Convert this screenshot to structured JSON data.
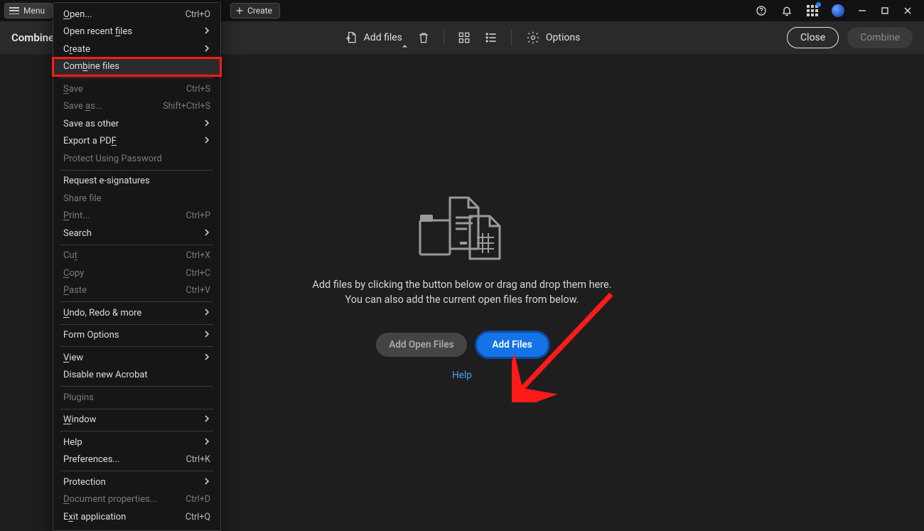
{
  "titlebar": {
    "menu_label": "Menu",
    "create_label": "Create"
  },
  "toolbar": {
    "title": "Combine files",
    "add_files_label": "Add files",
    "options_label": "Options",
    "close_label": "Close",
    "combine_label": "Combine"
  },
  "empty_state": {
    "line1": "Add files by clicking the button below or drag and drop them here.",
    "line2": "You can also add the current open files from below.",
    "add_open_label": "Add Open Files",
    "add_files_label": "Add Files",
    "help_label": "Help"
  },
  "menu": {
    "items": [
      {
        "label": "Open...",
        "underline": 0,
        "shortcut": "Ctrl+O",
        "submenu": false,
        "disabled": false,
        "highlight": false,
        "sep_after": false
      },
      {
        "label": "Open recent files",
        "underline": 12,
        "shortcut": "",
        "submenu": true,
        "disabled": false,
        "highlight": false,
        "sep_after": false
      },
      {
        "label": "Create",
        "underline": 1,
        "shortcut": "",
        "submenu": true,
        "disabled": false,
        "highlight": false,
        "sep_after": false
      },
      {
        "label": "Combine files",
        "underline": 3,
        "shortcut": "",
        "submenu": false,
        "disabled": false,
        "highlight": true,
        "sep_after": true
      },
      {
        "label": "Save",
        "underline": 0,
        "shortcut": "Ctrl+S",
        "submenu": false,
        "disabled": true,
        "highlight": false,
        "sep_after": false
      },
      {
        "label": "Save as...",
        "underline": 5,
        "shortcut": "Shift+Ctrl+S",
        "submenu": false,
        "disabled": true,
        "highlight": false,
        "sep_after": false
      },
      {
        "label": "Save as other",
        "underline": -1,
        "shortcut": "",
        "submenu": true,
        "disabled": false,
        "highlight": false,
        "sep_after": false
      },
      {
        "label": "Export a PDF",
        "underline": 11,
        "shortcut": "",
        "submenu": true,
        "disabled": false,
        "highlight": false,
        "sep_after": false
      },
      {
        "label": "Protect Using Password",
        "underline": -1,
        "shortcut": "",
        "submenu": false,
        "disabled": true,
        "highlight": false,
        "sep_after": true
      },
      {
        "label": "Request e-signatures",
        "underline": -1,
        "shortcut": "",
        "submenu": false,
        "disabled": false,
        "highlight": false,
        "sep_after": false
      },
      {
        "label": "Share file",
        "underline": -1,
        "shortcut": "",
        "submenu": false,
        "disabled": true,
        "highlight": false,
        "sep_after": false
      },
      {
        "label": "Print...",
        "underline": 0,
        "shortcut": "Ctrl+P",
        "submenu": false,
        "disabled": true,
        "highlight": false,
        "sep_after": false
      },
      {
        "label": "Search",
        "underline": -1,
        "shortcut": "",
        "submenu": true,
        "disabled": false,
        "highlight": false,
        "sep_after": true
      },
      {
        "label": "Cut",
        "underline": 2,
        "shortcut": "Ctrl+X",
        "submenu": false,
        "disabled": true,
        "highlight": false,
        "sep_after": false
      },
      {
        "label": "Copy",
        "underline": 0,
        "shortcut": "Ctrl+C",
        "submenu": false,
        "disabled": true,
        "highlight": false,
        "sep_after": false
      },
      {
        "label": "Paste",
        "underline": 0,
        "shortcut": "Ctrl+V",
        "submenu": false,
        "disabled": true,
        "highlight": false,
        "sep_after": true
      },
      {
        "label": "Undo, Redo & more",
        "underline": 0,
        "shortcut": "",
        "submenu": true,
        "disabled": false,
        "highlight": false,
        "sep_after": true
      },
      {
        "label": "Form Options",
        "underline": -1,
        "shortcut": "",
        "submenu": true,
        "disabled": false,
        "highlight": false,
        "sep_after": true
      },
      {
        "label": "View",
        "underline": 0,
        "shortcut": "",
        "submenu": true,
        "disabled": false,
        "highlight": false,
        "sep_after": false
      },
      {
        "label": "Disable new Acrobat",
        "underline": -1,
        "shortcut": "",
        "submenu": false,
        "disabled": false,
        "highlight": false,
        "sep_after": true
      },
      {
        "label": "Plugins",
        "underline": -1,
        "shortcut": "",
        "submenu": false,
        "disabled": true,
        "highlight": false,
        "sep_after": true
      },
      {
        "label": "Window",
        "underline": 0,
        "shortcut": "",
        "submenu": true,
        "disabled": false,
        "highlight": false,
        "sep_after": true
      },
      {
        "label": "Help",
        "underline": -1,
        "shortcut": "",
        "submenu": true,
        "disabled": false,
        "highlight": false,
        "sep_after": false
      },
      {
        "label": "Preferences...",
        "underline": -1,
        "shortcut": "Ctrl+K",
        "submenu": false,
        "disabled": false,
        "highlight": false,
        "sep_after": true
      },
      {
        "label": "Protection",
        "underline": -1,
        "shortcut": "",
        "submenu": true,
        "disabled": false,
        "highlight": false,
        "sep_after": false
      },
      {
        "label": "Document properties...",
        "underline": 0,
        "shortcut": "Ctrl+D",
        "submenu": false,
        "disabled": true,
        "highlight": false,
        "sep_after": false
      },
      {
        "label": "Exit application",
        "underline": 1,
        "shortcut": "Ctrl+Q",
        "submenu": false,
        "disabled": false,
        "highlight": false,
        "sep_after": false
      }
    ]
  }
}
